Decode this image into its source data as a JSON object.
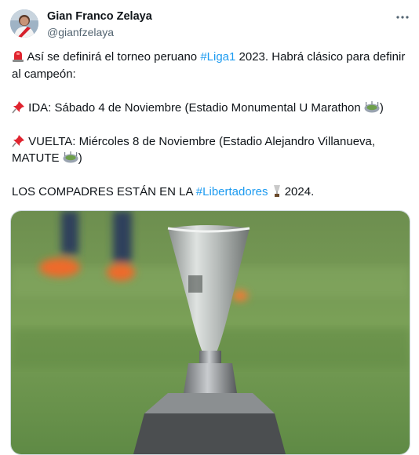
{
  "author": {
    "name": "Gian Franco Zelaya",
    "handle": "@gianfzelaya"
  },
  "icons": {
    "siren": "police-light-icon",
    "pin1": "pushpin-icon",
    "pin2": "pushpin-icon",
    "stadium1": "stadium-icon",
    "stadium2": "stadium-icon",
    "trophy": "trophy-icon",
    "more": "more-options-icon"
  },
  "tweet": {
    "line1_pre": " Así se definirá el torneo peruano ",
    "line1_hashtag": "#Liga1",
    "line1_post": " 2023. Habrá clásico para definir al campeón:",
    "ida_text": " IDA: Sábado 4 de Noviembre (Estadio Monumental U Marathon ",
    "ida_close": ")",
    "vuelta_text": " VUELTA: Miércoles 8 de Noviembre (Estadio Alejandro Villanueva, MATUTE ",
    "vuelta_close": ")",
    "last_pre": "LOS COMPADRES ESTÁN EN LA ",
    "last_hashtag": "#Libertadores",
    "last_post": " 2024."
  },
  "colors": {
    "hashtag": "#1d9bf0",
    "name": "#0f1419",
    "handle": "#536471",
    "field": "#6f9a4f"
  }
}
